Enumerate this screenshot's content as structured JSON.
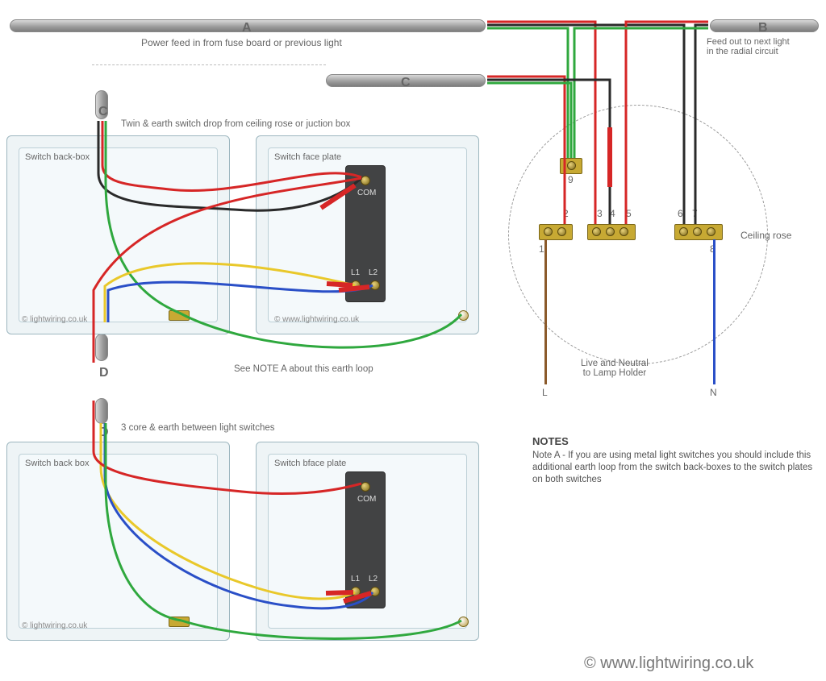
{
  "conduits": {
    "A": {
      "letter": "A",
      "caption": "Power feed in from fuse board or previous light"
    },
    "B": {
      "letter": "B",
      "caption": "Feed out to next light\nin the radial circuit"
    },
    "C_top": {
      "letter": "C"
    },
    "C_side": {
      "letter": "C",
      "caption": "Twin & earth switch drop from ceiling rose or juction box"
    },
    "D_mid": {
      "letter": "D",
      "caption": "See NOTE A about this earth loop"
    },
    "D_lower": {
      "letter": "D",
      "caption": "3 core & earth between light switches"
    }
  },
  "boxes": {
    "topBackbox": "Switch back-box",
    "topFaceplate": "Switch face plate",
    "bottomBackbox": "Switch back box",
    "bottomFaceplate": "Switch bface plate"
  },
  "plateTerminals": {
    "com": "COM",
    "l1": "L1",
    "l2": "L2"
  },
  "rose": {
    "label": "Ceiling rose",
    "earthLabel": "9",
    "terminals": [
      "1",
      "2",
      "3",
      "4",
      "5",
      "6",
      "7",
      "8"
    ],
    "pendant": "Live and Neutral\nto Lamp Holder",
    "L": "L",
    "N": "N"
  },
  "notes": {
    "heading": "NOTES",
    "text": "Note A - If you are using metal light switches you should include this additional earth loop from the switch back-boxes to the switch plates on both switches"
  },
  "copyright": {
    "smallA": "© lightwiring.co.uk",
    "smallB": "© www.lightwiring.co.uk",
    "smallC": "© lightwiring.co.uk",
    "big": "© www.lightwiring.co.uk"
  },
  "wire_colors": {
    "live": "#d62626",
    "neutral": "#2a2a2a",
    "neutral_new": "#2a4fc7",
    "earth": "#2fa83e",
    "strap1": "#e9c82a",
    "strap2": "#2a4fc7",
    "brown": "#8b5a2b"
  }
}
